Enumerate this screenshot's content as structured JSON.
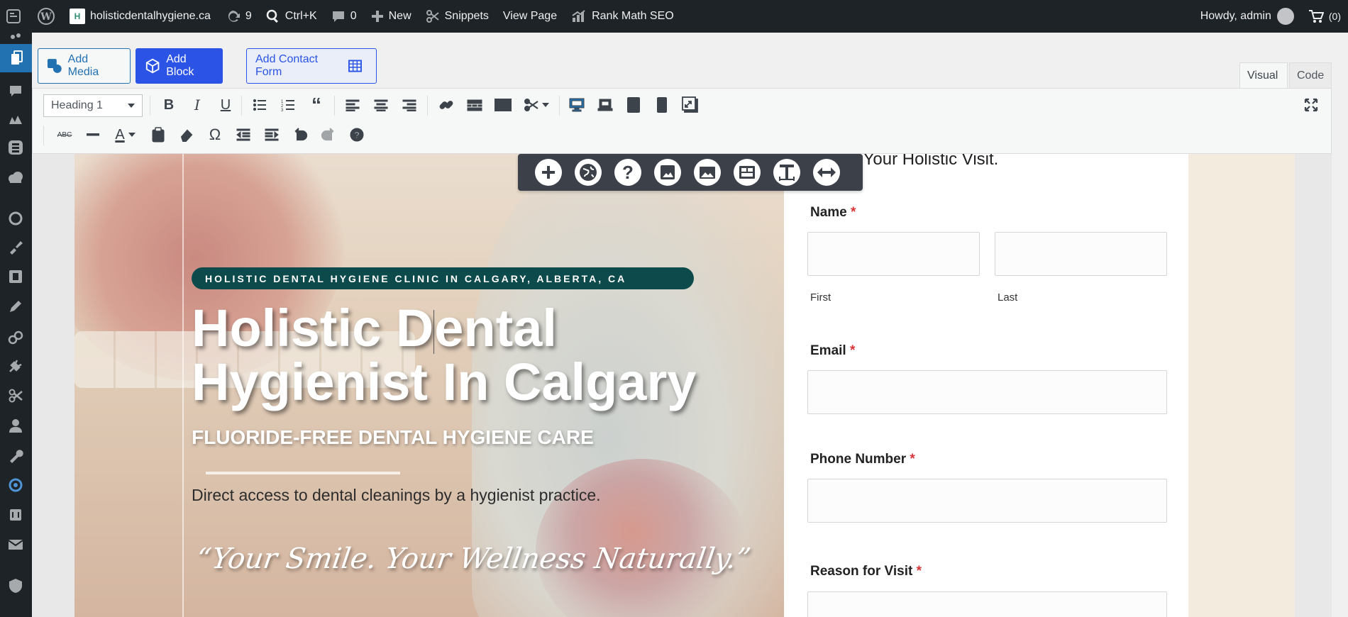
{
  "adminbar": {
    "site_name": "holisticdentalhygiene.ca",
    "updates_count": "9",
    "search_shortcut": "Ctrl+K",
    "comments_count": "0",
    "new_label": "New",
    "snippets_label": "Snippets",
    "view_page_label": "View Page",
    "rank_math_label": "Rank Math SEO",
    "howdy_label": "Howdy, admin",
    "cart_count": "(0)"
  },
  "editor": {
    "add_media_label": "Add Media",
    "add_block_label": "Add Block",
    "add_contact_form_label": "Add Contact Form",
    "tab_visual": "Visual",
    "tab_code": "Code",
    "format_select_value": "Heading 1"
  },
  "hero": {
    "badge": "HOLISTIC DENTAL HYGIENE CLINIC IN CALGARY, ALBERTA, CA",
    "title_line1_a": "Holistic D",
    "title_line1_b": "ental",
    "title_line2": "Hygienist In Calgary",
    "subtitle": "FLUORIDE-FREE DENTAL HYGIENE CARE",
    "description": "Direct access to dental cleanings by a hygienist practice.",
    "quote": "“Your Smile. Your Wellness Naturally.”"
  },
  "form": {
    "title_partial": "ve Your Holistic Visit.",
    "name_label": "Name",
    "first_label": "First",
    "last_label": "Last",
    "email_label": "Email",
    "phone_label": "Phone Number",
    "reason_label": "Reason for Visit",
    "required_mark": "*"
  },
  "colors": {
    "adminbar_bg": "#1d2327",
    "primary_blue": "#2b54e6",
    "badge_teal": "#0d4a4c",
    "required_red": "#d63638"
  }
}
